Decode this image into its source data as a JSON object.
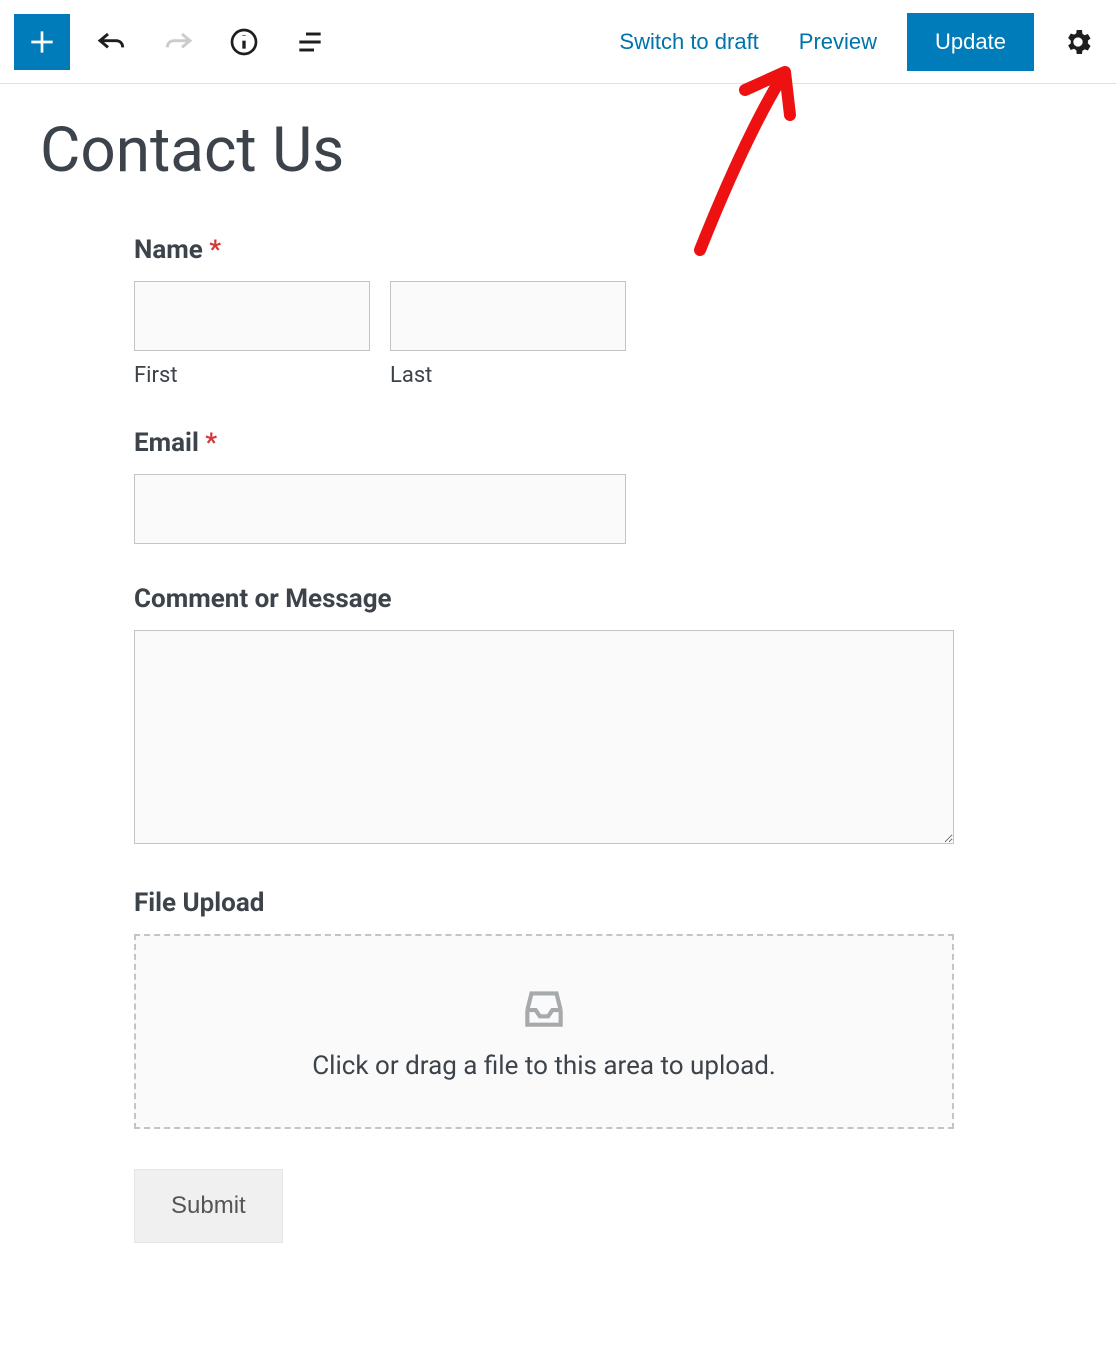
{
  "toolbar": {
    "switch_to_draft": "Switch to draft",
    "preview": "Preview",
    "update": "Update"
  },
  "page": {
    "title": "Contact Us"
  },
  "form": {
    "name": {
      "label": "Name",
      "required_mark": "*",
      "first_sublabel": "First",
      "last_sublabel": "Last"
    },
    "email": {
      "label": "Email",
      "required_mark": "*"
    },
    "message": {
      "label": "Comment or Message"
    },
    "file_upload": {
      "label": "File Upload",
      "hint": "Click or drag a file to this area to upload."
    },
    "submit_label": "Submit"
  }
}
